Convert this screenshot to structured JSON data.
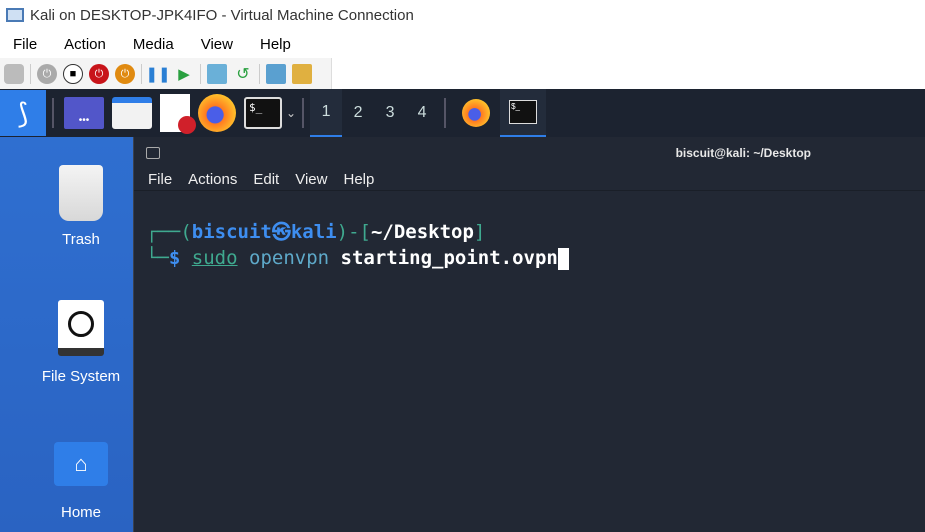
{
  "window": {
    "title": "Kali on DESKTOP-JPK4IFO - Virtual Machine Connection"
  },
  "menu": [
    "File",
    "Action",
    "Media",
    "View",
    "Help"
  ],
  "panel": {
    "workspaces": [
      "1",
      "2",
      "3",
      "4"
    ],
    "active_workspace": "1",
    "colors": {
      "accent": "#2f7ee8",
      "panel_bg": "#1c2330"
    }
  },
  "desktop": {
    "icons": [
      {
        "label": "Trash"
      },
      {
        "label": "File System"
      },
      {
        "label": "Home"
      }
    ]
  },
  "terminal": {
    "title": "biscuit@kali: ~/Desktop",
    "menu": [
      "File",
      "Actions",
      "Edit",
      "View",
      "Help"
    ],
    "prompt": {
      "open": "┌──(",
      "user": "biscuit",
      "sep": "㉿",
      "host": "kali",
      "mid": ")-[",
      "path": "~/Desktop",
      "close": "]",
      "line2": "└─",
      "dollar": "$ "
    },
    "command": {
      "cmd": "sudo",
      "arg1": "openvpn",
      "arg2": "starting_point.ovpn"
    }
  }
}
